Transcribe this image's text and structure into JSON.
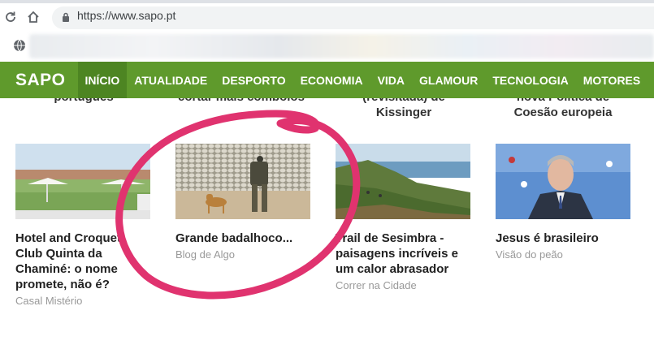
{
  "browser": {
    "url": "https://www.sapo.pt",
    "icons": [
      "reload-icon",
      "home-icon",
      "lock-icon",
      "globe-icon"
    ]
  },
  "site": {
    "logo": "SAPO",
    "nav": [
      "INÍCIO",
      "ATUALIDADE",
      "DESPORTO",
      "ECONOMIA",
      "VIDA",
      "GLAMOUR",
      "TECNOLOGIA",
      "MOTORES"
    ],
    "active_index": 0,
    "colors": {
      "nav_bg": "#5f9a2c",
      "nav_active": "#4d8522",
      "highlight": "#e0336f"
    }
  },
  "clipped_headlines": [
    {
      "lines": [
        "português"
      ]
    },
    {
      "lines": [
        "cortar mais comboios"
      ]
    },
    {
      "lines": [
        "(revisitada) de",
        "Kissinger"
      ]
    },
    {
      "lines": [
        "nova Política de",
        "Coesão europeia"
      ]
    }
  ],
  "cards": [
    {
      "title": "Hotel and Croquet Club Quinta da Chaminé: o nome promete, não é?",
      "source": "Casal Mistério"
    },
    {
      "title": "Grande badalhoco...",
      "source": "Blog de Algo"
    },
    {
      "title": "Trail de Sesimbra - paisagens incríveis e um calor abrasador",
      "source": "Correr na Cidade"
    },
    {
      "title": "Jesus é brasileiro",
      "source": "Visão do peão"
    }
  ]
}
